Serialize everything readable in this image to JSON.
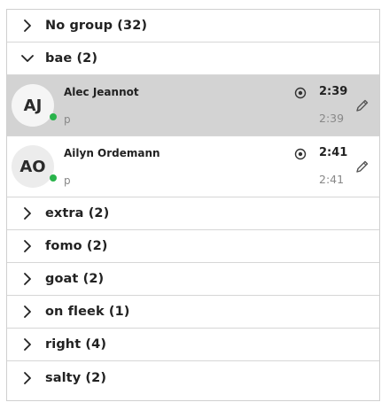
{
  "groups_top": [
    {
      "label": "No group (32)",
      "expanded": false,
      "icon": "chevron-right-icon"
    },
    {
      "label": "bae (2)",
      "expanded": true,
      "icon": "chevron-down-icon"
    }
  ],
  "members": [
    {
      "initials": "AJ",
      "name": "Alec Jeannot",
      "sub": "p",
      "time": "2:39",
      "time_sub": "2:39",
      "status": "online",
      "status_color": "#29b34b",
      "selected": true,
      "pin_icon": "location-pin-icon",
      "edit_icon": "pencil-icon"
    },
    {
      "initials": "AO",
      "name": "Ailyn Ordemann",
      "sub": "p",
      "time": "2:41",
      "time_sub": "2:41",
      "status": "online",
      "status_color": "#29b34b",
      "selected": false,
      "pin_icon": "location-pin-icon",
      "edit_icon": "pencil-icon"
    }
  ],
  "groups_bottom": [
    {
      "label": "extra (2)",
      "expanded": false,
      "icon": "chevron-right-icon"
    },
    {
      "label": "fomo (2)",
      "expanded": false,
      "icon": "chevron-right-icon"
    },
    {
      "label": "goat (2)",
      "expanded": false,
      "icon": "chevron-right-icon"
    },
    {
      "label": "on fleek (1)",
      "expanded": false,
      "icon": "chevron-right-icon"
    },
    {
      "label": "right (4)",
      "expanded": false,
      "icon": "chevron-right-icon"
    },
    {
      "label": "salty (2)",
      "expanded": false,
      "icon": "chevron-right-icon"
    }
  ],
  "colors": {
    "selected_bg": "#d3d3d3",
    "divider": "#d6d6d6",
    "online": "#29b34b"
  }
}
